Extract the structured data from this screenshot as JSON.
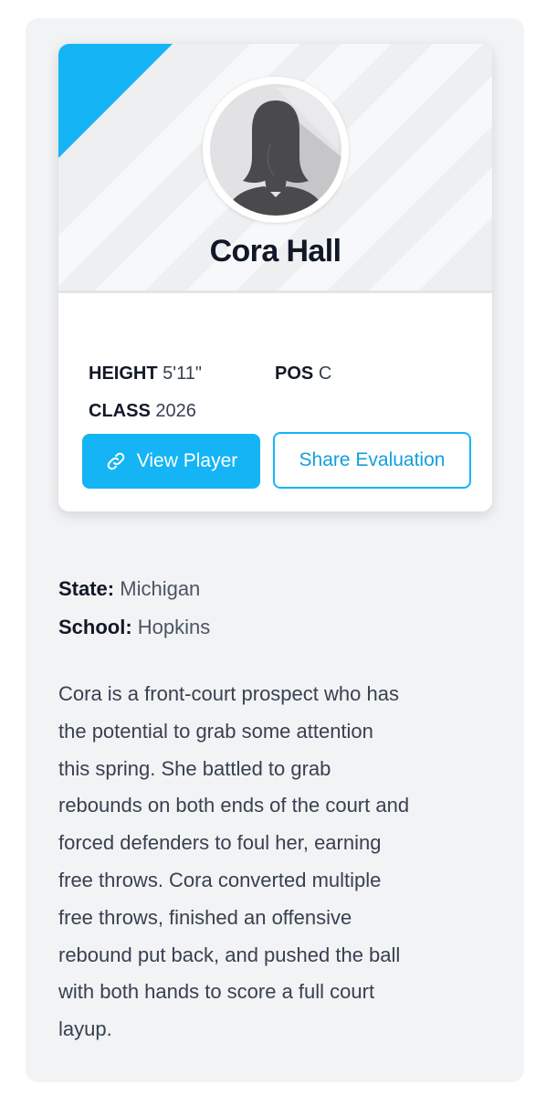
{
  "player": {
    "name": "Cora Hall",
    "height_label": "HEIGHT",
    "height_value": "5'11\"",
    "position_label": "POS",
    "position_value": "C",
    "class_label": "CLASS",
    "class_value": "2026"
  },
  "actions": {
    "view_player": "View Player",
    "share_evaluation": "Share Evaluation"
  },
  "details": {
    "state_label": "State:",
    "state_value": "Michigan",
    "school_label": "School:",
    "school_value": "Hopkins"
  },
  "evaluation": {
    "lines": [
      "Cora is a front-court prospect who has",
      "the potential to grab some attention",
      "this spring. She battled to grab",
      "rebounds on both ends of the court and",
      "forced defenders to foul her, earning",
      "free throws. Cora converted multiple",
      "free throws, finished an offensive",
      "rebound put back, and pushed the ball",
      "with both hands to score a full court",
      "layup."
    ]
  },
  "colors": {
    "accent": "#14b4f5",
    "panel_background": "#f2f3f5",
    "header_background": "#eeeff1"
  },
  "icons": {
    "view_player": "link-icon",
    "avatar": "female-silhouette-icon"
  }
}
